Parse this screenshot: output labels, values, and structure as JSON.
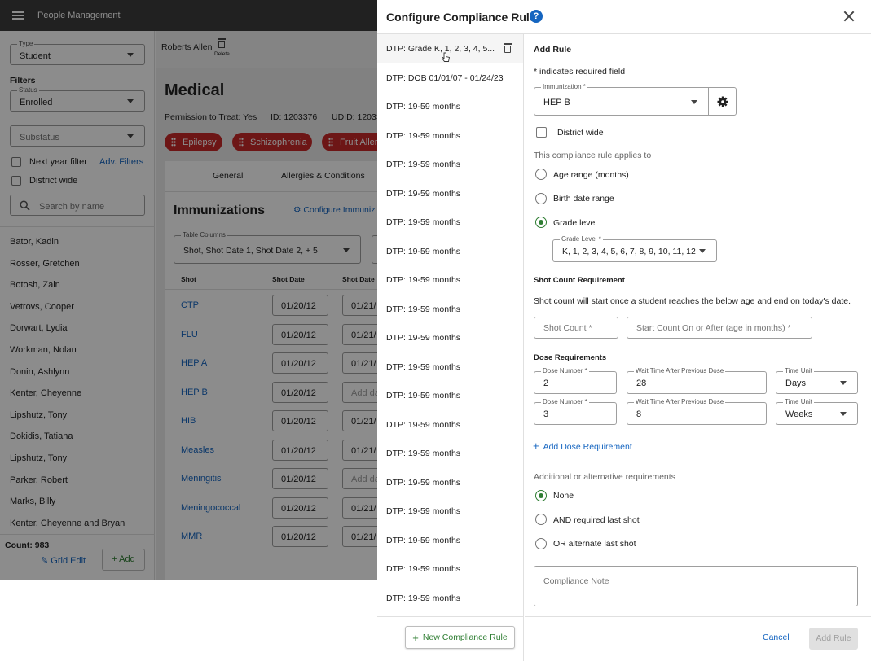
{
  "app": {
    "title": "People Management",
    "sidebar": {
      "type_label": "Type",
      "type_value": "Student",
      "filters_heading": "Filters",
      "status_label": "Status",
      "status_value": "Enrolled",
      "substatus_placeholder": "Substatus",
      "next_year_filter": "Next year filter",
      "adv_filters": "Adv. Filters",
      "district_wide": "District wide",
      "search_placeholder": "Search by name",
      "people": [
        "Bator, Kadin",
        "Rosser, Gretchen",
        "Botosh, Zain",
        "Vetrovs, Cooper",
        "Dorwart, Lydia",
        "Workman, Nolan",
        "Donin, Ashlynn",
        "Kenter, Cheyenne",
        "Lipshutz, Tony",
        "Dokidis, Tatiana",
        "Lipshutz, Tony",
        "Parker, Robert",
        "Marks, Billy",
        "Kenter, Cheyenne and Bryan"
      ],
      "count": "Count: 983",
      "grid_edit": "Grid Edit",
      "add": "Add"
    },
    "content": {
      "student_name": "Roberts Allen",
      "delete_label": "Delete",
      "section_title": "Medical",
      "permission": "Permission to Treat: Yes",
      "id": "ID: 1203376",
      "udid": "UDID: 12033",
      "conditions": [
        "Epilepsy",
        "Schizophrenia",
        "Fruit Aller"
      ],
      "tabs": [
        "General",
        "Allergies & Conditions"
      ],
      "immunizations_title": "Immunizations",
      "configure_link": "Configure Immuniz",
      "table_columns_label": "Table Columns",
      "table_columns_value": "Shot, Shot Date 1, Shot Date 2, + 5",
      "col_headers": [
        "Shot",
        "Shot Date",
        "Shot Date"
      ],
      "shots": [
        {
          "name": "CTP",
          "d1": "01/20/12",
          "d2": "01/21/"
        },
        {
          "name": "FLU",
          "d1": "01/20/12",
          "d2": "01/21/"
        },
        {
          "name": "HEP A",
          "d1": "01/20/12",
          "d2": "01/21/"
        },
        {
          "name": "HEP B",
          "d1": "01/20/12",
          "d2": "Add da"
        },
        {
          "name": "HIB",
          "d1": "01/20/12",
          "d2": "01/21/"
        },
        {
          "name": "Measles",
          "d1": "01/20/12",
          "d2": "01/21/"
        },
        {
          "name": "Meningitis",
          "d1": "01/20/12",
          "d2": "Add da"
        },
        {
          "name": "Meningococcal",
          "d1": "01/20/12",
          "d2": "01/21/"
        },
        {
          "name": "MMR",
          "d1": "01/20/12",
          "d2": "01/21/"
        }
      ]
    }
  },
  "dialog": {
    "title": "Configure Compliance Rules",
    "rules": [
      "DTP: Grade K, 1, 2, 3, 4, 5...",
      "DTP: DOB 01/01/07 - 01/24/23",
      "DTP: 19-59 months",
      "DTP: 19-59 months",
      "DTP: 19-59 months",
      "DTP: 19-59 months",
      "DTP: 19-59 months",
      "DTP: 19-59 months",
      "DTP: 19-59 months",
      "DTP: 19-59 months",
      "DTP: 19-59 months",
      "DTP: 19-59 months",
      "DTP: 19-59 months",
      "DTP: 19-59 months",
      "DTP: 19-59 months",
      "DTP: 19-59 months",
      "DTP: 19-59 months",
      "DTP: 19-59 months",
      "DTP: 19-59 months",
      "DTP: 19-59 months"
    ],
    "new_rule_button": "New Compliance Rule",
    "form": {
      "heading": "Add Rule",
      "required_note": "* indicates required field",
      "immunization_label": "Immunization *",
      "immunization_value": "HEP B",
      "district_wide": "District wide",
      "applies_to": "This compliance rule applies to",
      "options": [
        "Age range (months)",
        "Birth date range",
        "Grade level"
      ],
      "selected_option": "Grade level",
      "grade_level_label": "Grade Level *",
      "grade_level_value": "K, 1, 2, 3, 4, 5, 6, 7, 8, 9, 10, 11, 12",
      "shot_count_heading": "Shot Count Requirement",
      "shot_count_desc": "Shot count will start once a student reaches the below age and end on today's date.",
      "shot_count_placeholder": "Shot Count *",
      "start_count_placeholder": "Start Count On or After (age in months) *",
      "dose_heading": "Dose Requirements",
      "doses": [
        {
          "dose_label": "Dose Number *",
          "dose": "2",
          "wait_label": "Wait Time After Previous Dose",
          "wait": "28",
          "unit_label": "Time Unit",
          "unit": "Days"
        },
        {
          "dose_label": "Dose Number *",
          "dose": "3",
          "wait_label": "Wait Time After Previous Dose",
          "wait": "8",
          "unit_label": "Time Unit",
          "unit": "Weeks"
        }
      ],
      "add_dose": "Add Dose Requirement",
      "additional_heading": "Additional or alternative requirements",
      "additional_options": [
        "None",
        "AND required last shot",
        "OR alternate last shot"
      ],
      "additional_selected": "None",
      "note_placeholder": "Compliance Note"
    },
    "cancel": "Cancel",
    "add_rule": "Add Rule"
  },
  "colors": {
    "appbar": "#3c3c3c",
    "primary_link": "#1565c0",
    "accent_green": "#2e7d32",
    "condition_pill": "#c62828"
  }
}
